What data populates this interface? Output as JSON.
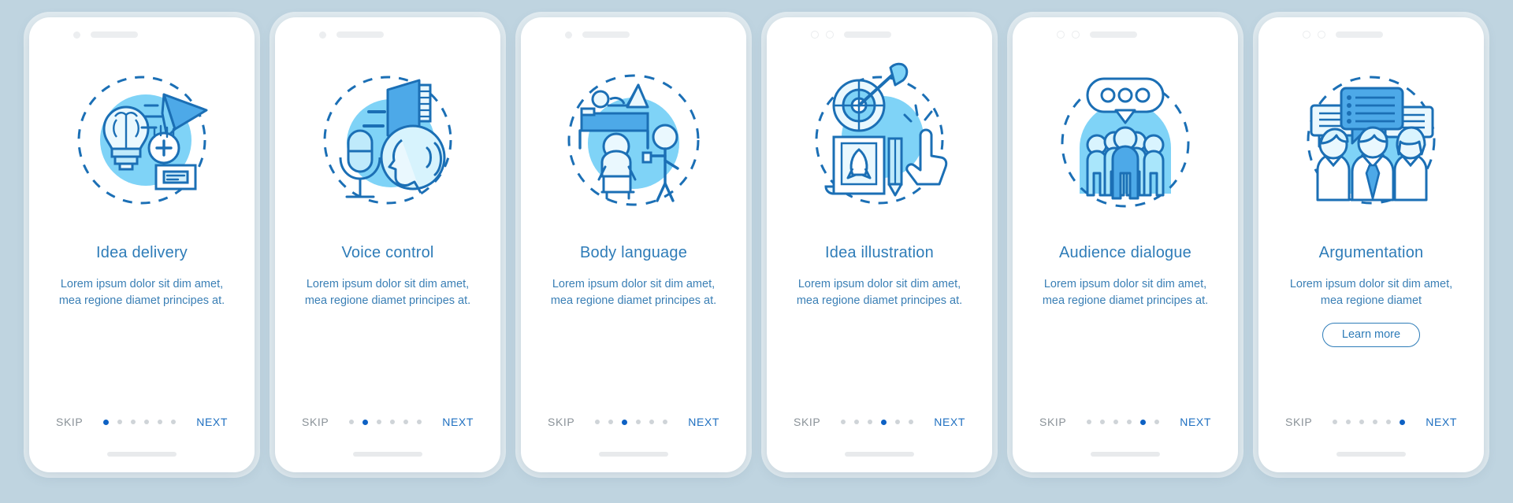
{
  "meta": {
    "background_color": "#bfd4e0",
    "card_background": "#ffffff",
    "accent_blue": "#2e7cb8",
    "active_dot_color": "#0d61c4",
    "inactive_dot_color": "#cfd4d8",
    "skip_color": "#8a9298",
    "next_color": "#1e6fc0",
    "illustration_fill_light": "#7fd3f7",
    "illustration_fill_mid": "#4da9e8",
    "illustration_stroke": "#1b6fb5"
  },
  "common": {
    "skip_label": "SKIP",
    "next_label": "NEXT",
    "dot_count": 6
  },
  "screens": [
    {
      "id": "idea-delivery",
      "title": "Idea delivery",
      "description": "Lorem ipsum dolor sit dim amet, mea regione diamet principes at.",
      "active_dot": 1,
      "notch_style": "dot-bar",
      "illustration": "lightbulb-brain-paper-plane-icon",
      "has_learn_more": false,
      "learn_more_label": null
    },
    {
      "id": "voice-control",
      "title": "Voice control",
      "description": "Lorem ipsum dolor sit dim amet, mea regione diamet principes at.",
      "active_dot": 2,
      "notch_style": "dot-bar",
      "illustration": "megaphone-microphone-speaking-head-icon",
      "has_learn_more": false,
      "learn_more_label": null
    },
    {
      "id": "body-language",
      "title": "Body language",
      "description": "Lorem ipsum dolor sit dim amet, mea regione diamet principes at.",
      "active_dot": 3,
      "notch_style": "dot-bar",
      "illustration": "two-people-posture-icon",
      "has_learn_more": false,
      "learn_more_label": null
    },
    {
      "id": "idea-illustration",
      "title": "Idea illustration",
      "description": "Lorem ipsum dolor sit dim amet, mea regione diamet principes at.",
      "active_dot": 4,
      "notch_style": "rings-bar",
      "illustration": "target-dart-rocket-sketch-icon",
      "has_learn_more": false,
      "learn_more_label": null
    },
    {
      "id": "audience-dialogue",
      "title": "Audience dialogue",
      "description": "Lorem ipsum dolor sit dim amet, mea regione diamet principes at.",
      "active_dot": 5,
      "notch_style": "rings-bar",
      "illustration": "crowd-speech-bubble-icon",
      "has_learn_more": false,
      "learn_more_label": null
    },
    {
      "id": "argumentation",
      "title": "Argumentation",
      "description": "Lorem ipsum dolor sit dim amet, mea regione diamet",
      "active_dot": 6,
      "notch_style": "rings-bar",
      "illustration": "three-people-chat-bubbles-icon",
      "has_learn_more": true,
      "learn_more_label": "Learn more"
    }
  ]
}
